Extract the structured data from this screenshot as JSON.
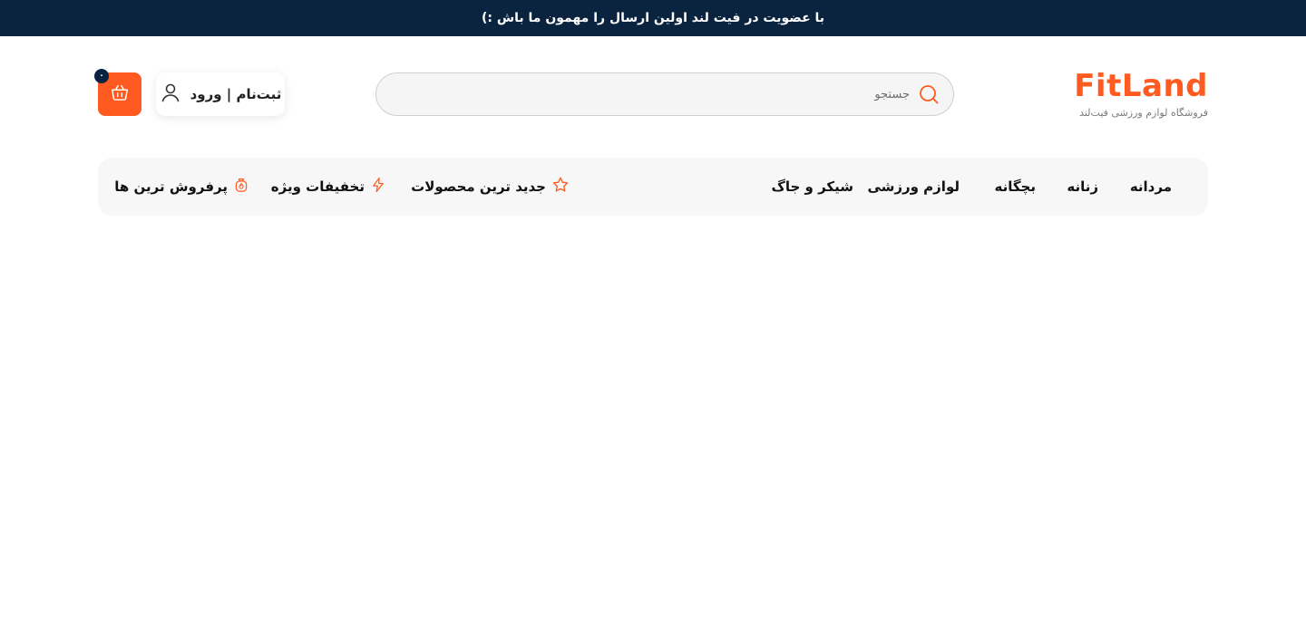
{
  "announcement": "با عضویت در فیت لند اولین ارسال را مهمون ما باش :)",
  "logo": {
    "text": "FitLand",
    "subtitle": "فروشگاه لوازم ورزشی فیت‌لند"
  },
  "search": {
    "placeholder": "جستجو",
    "value": ""
  },
  "login": {
    "label": "ثبت‌نام | ورود"
  },
  "cart": {
    "count": "۰"
  },
  "nav": {
    "categories": [
      "مردانه",
      "زنانه",
      "بچگانه",
      "لوازم ورزشی",
      "شیکر و جاگ"
    ],
    "specials": [
      {
        "label": "جدید ترین محصولات",
        "icon": "star-icon"
      },
      {
        "label": "تخفیفات ویژه",
        "icon": "lightning-icon"
      },
      {
        "label": "پرفروش ترین ها",
        "icon": "flame-badge-icon"
      }
    ]
  },
  "colors": {
    "accent": "#ff5a1f",
    "topbar": "#0a2440",
    "nav_bg": "#f7f7f7"
  }
}
